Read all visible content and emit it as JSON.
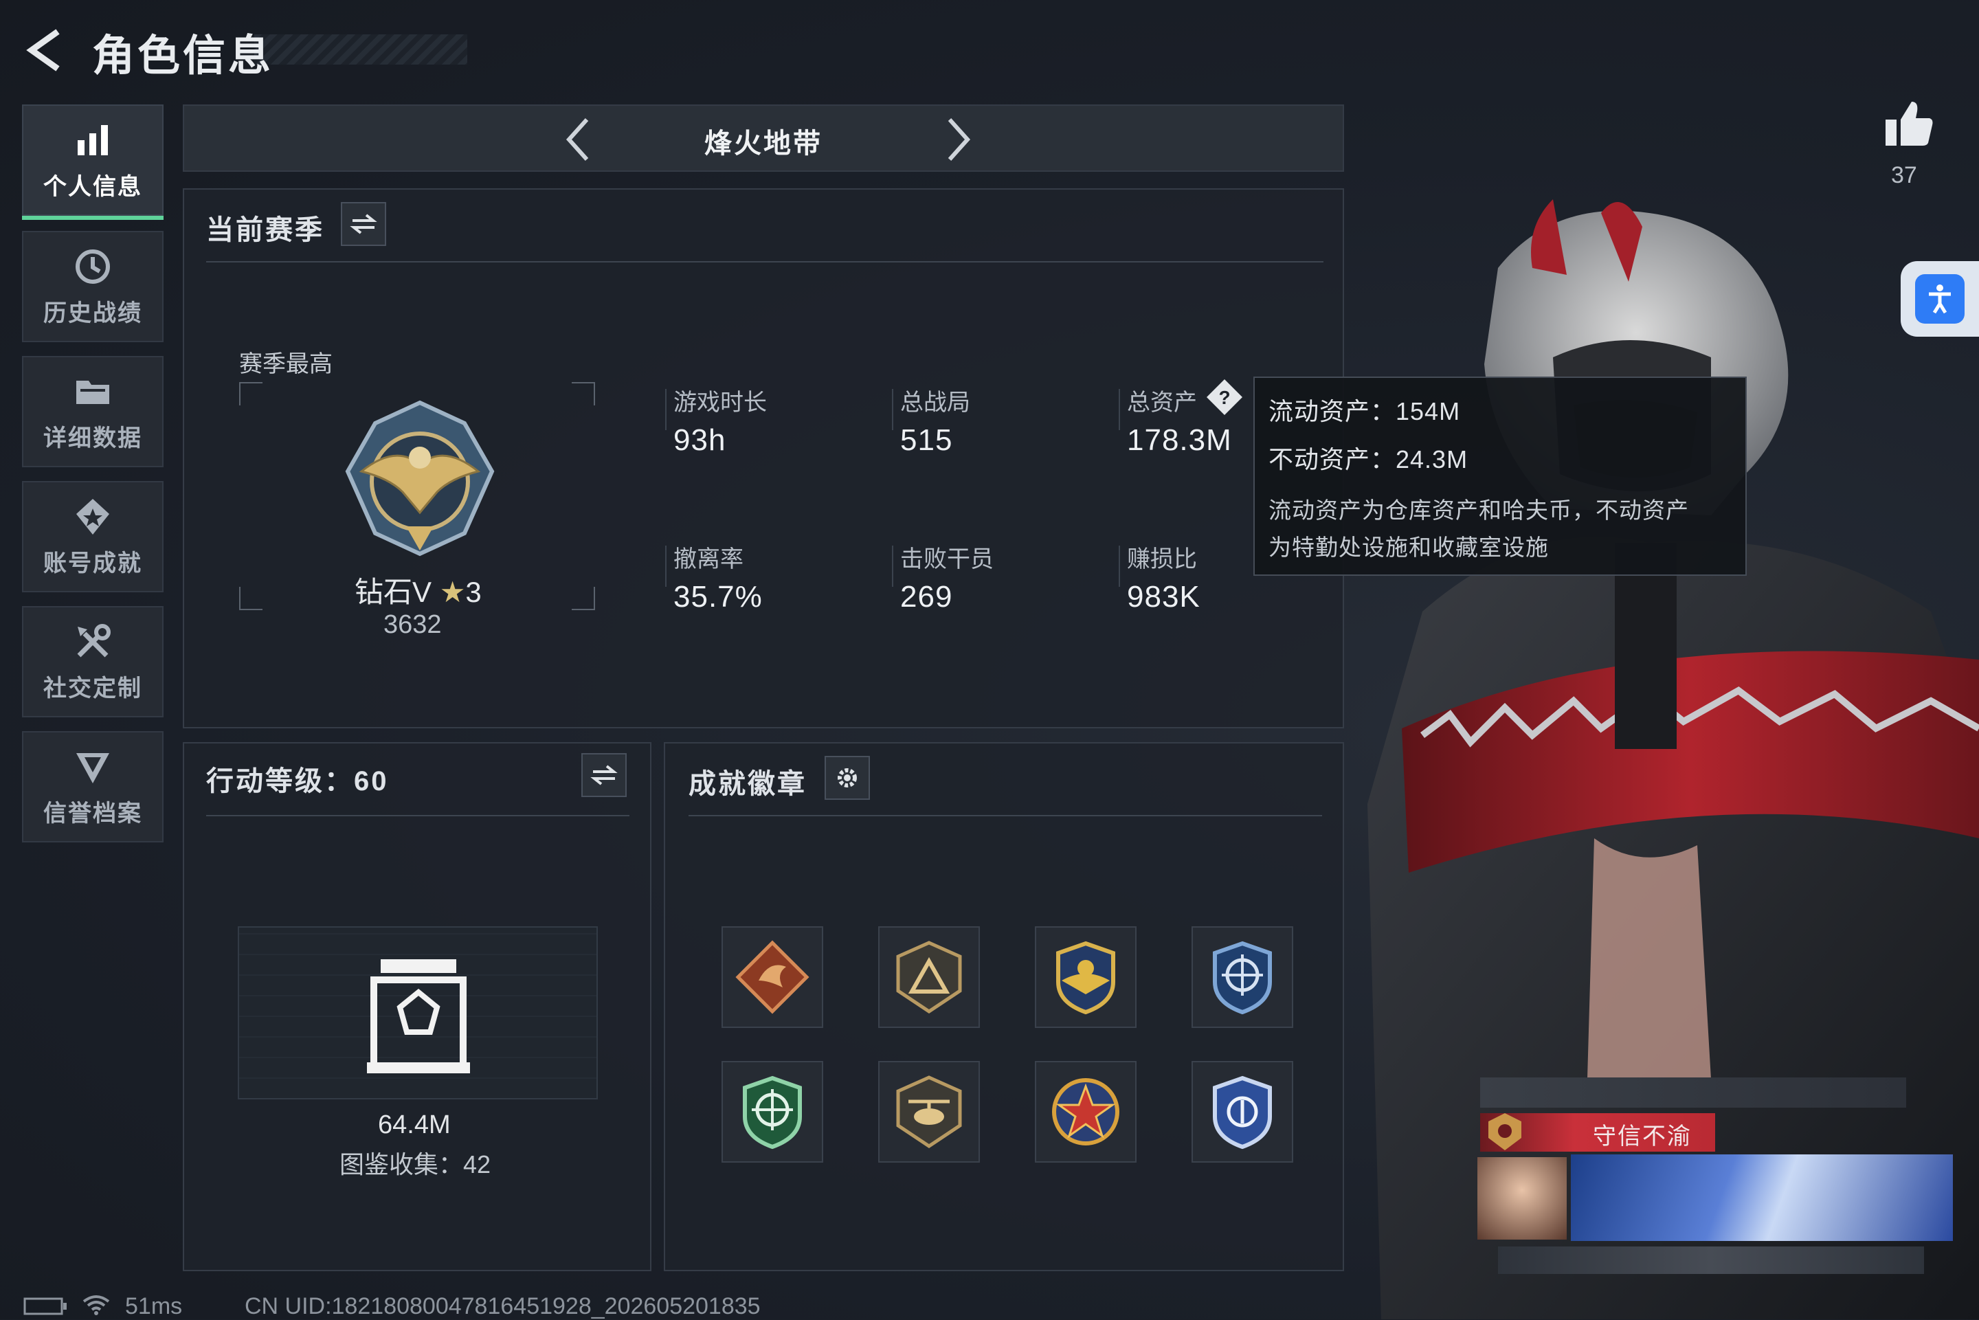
{
  "header": {
    "title": "角色信息"
  },
  "sidebar": {
    "items": [
      {
        "label": "个人信息",
        "icon": "bar-chart-icon",
        "active": true
      },
      {
        "label": "历史战绩",
        "icon": "history-clock-icon"
      },
      {
        "label": "详细数据",
        "icon": "folder-icon"
      },
      {
        "label": "账号成就",
        "icon": "achievement-icon"
      },
      {
        "label": "社交定制",
        "icon": "tools-icon"
      },
      {
        "label": "信誉档案",
        "icon": "reputation-icon"
      }
    ]
  },
  "mode": {
    "title": "烽火地带"
  },
  "season": {
    "title": "当前赛季",
    "best_label": "赛季最高",
    "rank_name": "钻石V",
    "rank_stars": "3",
    "rank_score": "3632",
    "stats": [
      {
        "label": "游戏时长",
        "value": "93h"
      },
      {
        "label": "总战局",
        "value": "515"
      },
      {
        "label": "总资产",
        "value": "178.3M"
      },
      {
        "label": "撤离率",
        "value": "35.7%"
      },
      {
        "label": "击败干员",
        "value": "269"
      },
      {
        "label": "赚损比",
        "value": "983K"
      }
    ]
  },
  "tooltip": {
    "liquid": "流动资产：154M",
    "fixed": "不动资产：24.3M",
    "desc_line1": "流动资产为仓库资产和哈夫币，不动资产",
    "desc_line2": "为特勤处设施和收藏室设施"
  },
  "action_level": {
    "title": "行动等级：60",
    "value": "64.4M",
    "collection": "图鉴收集：42"
  },
  "badges": {
    "title": "成就徽章",
    "items": [
      "dragon-badge-icon",
      "triangle-badge-icon",
      "wings-gold-badge-icon",
      "crosshair-blue-badge-icon",
      "crosshair-green-badge-icon",
      "helicopter-badge-icon",
      "star-badge-icon",
      "eagle-blue-badge-icon"
    ]
  },
  "likes": {
    "count": "37"
  },
  "honor": {
    "title": "守信不渝"
  },
  "status": {
    "ping": "51ms",
    "uid": "CN UID:18218080047816451928_202605201835"
  },
  "colors": {
    "accent": "#5fd39a",
    "background": "#1a1f27",
    "honor": "#c9303a",
    "access": "#2e7cf6"
  }
}
